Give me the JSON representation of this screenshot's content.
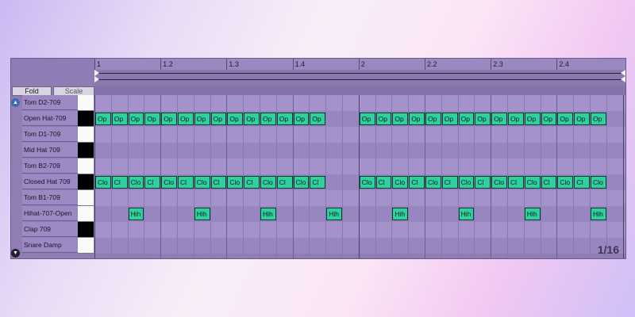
{
  "ruler": {
    "labels": [
      "1",
      "1.2",
      "1.3",
      "1.4",
      "2",
      "2.2",
      "2.3",
      "2.4"
    ]
  },
  "buttons": {
    "fold": "Fold",
    "scale": "Scale"
  },
  "zoom_label": "1/16",
  "lanes": [
    {
      "name": "Tom D2-709",
      "key": "white"
    },
    {
      "name": "Open Hat-709",
      "key": "black"
    },
    {
      "name": "Tom D1-709",
      "key": "white"
    },
    {
      "name": "Mid Hat 709",
      "key": "black"
    },
    {
      "name": "Tom B2-709",
      "key": "white"
    },
    {
      "name": "Closed Hat 709",
      "key": "black"
    },
    {
      "name": "Tom B1-709",
      "key": "white"
    },
    {
      "name": "Hihat-707-Open",
      "key": "white"
    },
    {
      "name": "Clap 709",
      "key": "black"
    },
    {
      "name": "Snare Damp",
      "key": "white"
    }
  ],
  "notes": [
    {
      "lane": 1,
      "label": "Op",
      "steps": [
        0,
        1,
        2,
        3,
        4,
        5,
        6,
        7,
        8,
        9,
        10,
        11,
        12,
        13,
        16,
        17,
        18,
        19,
        20,
        21,
        22,
        23,
        24,
        25,
        26,
        27,
        28,
        29,
        30
      ]
    },
    {
      "lane": 5,
      "label_pattern": [
        "Clo",
        "Cl"
      ],
      "steps": [
        0,
        1,
        2,
        3,
        4,
        5,
        6,
        7,
        8,
        9,
        10,
        11,
        12,
        13,
        16,
        17,
        18,
        19,
        20,
        21,
        22,
        23,
        24,
        25,
        26,
        27,
        28,
        29,
        30
      ]
    },
    {
      "lane": 7,
      "label": "Hih",
      "steps": [
        2,
        6,
        10,
        14,
        18,
        22,
        26,
        30
      ]
    }
  ],
  "colors": {
    "note": "#2fd0a0",
    "note_border": "#0a3a2a"
  }
}
